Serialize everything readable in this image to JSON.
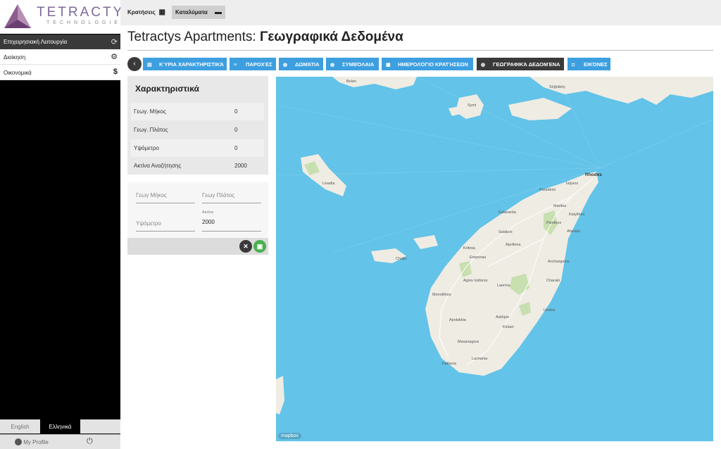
{
  "brand": {
    "name": "TETRACTYS",
    "sub": "TECHNOLOGIES"
  },
  "sidebar": {
    "section_label": "Επιχειρησιακή Λειτουργία",
    "section_icon": "refresh-icon",
    "items": [
      {
        "label": "Διοίκηση",
        "icon": "gear-icon"
      },
      {
        "label": "Οικονομικά",
        "icon": "dollar-icon"
      }
    ],
    "languages": [
      {
        "label": "English",
        "active": false
      },
      {
        "label": "Ελληνικά",
        "active": true
      }
    ],
    "profile_label": "My Profile",
    "profile_icon": "account-circle-icon",
    "logout_icon": "power-icon"
  },
  "topbar": {
    "buttons": [
      {
        "label": "Κρατήσεις",
        "icon": "calendar-icon"
      },
      {
        "label": "Καταλύματα",
        "icon": "bed-icon"
      }
    ]
  },
  "page": {
    "title_prefix": "Tetractys Apartments:",
    "title_main": "Γεωγραφικά Δεδομένα"
  },
  "tabs": [
    {
      "label": "ΚΎΡΙΑ ΧΑΡΑΚΤΗΡΙΣΤΙΚΆ",
      "icon": "document-icon",
      "active": false
    },
    {
      "label": "ΠΑΡΟΧΈΣ",
      "icon": "list-icon",
      "active": false
    },
    {
      "label": "ΔΩΜΆΤΙΑ",
      "icon": "globe-icon",
      "active": false
    },
    {
      "label": "ΣΥΜΒΌΛΑΙΑ",
      "icon": "globe-icon",
      "active": false
    },
    {
      "label": "ΗΜΕΡΟΛΌΓΙΟ ΚΡΑΤΉΣΕΩΝ",
      "icon": "calendar-icon",
      "active": false
    },
    {
      "label": "ΓΕΩΓΡΑΦΙΚΆ ΔΕΔΟΜΈΝΑ",
      "icon": "globe-icon",
      "active": true
    },
    {
      "label": "ΕΙΚΌΝΕΣ",
      "icon": "camera-icon",
      "active": false
    }
  ],
  "characteristics": {
    "title": "Χαρακτηριστικά",
    "rows": [
      {
        "label": "Γεωγ. Μήκος",
        "value": "0"
      },
      {
        "label": "Γεωγ. Πλάτος",
        "value": "0"
      },
      {
        "label": "Υψόμετρο",
        "value": "0"
      },
      {
        "label": "Ακτίνα Αναζήτησης",
        "value": "2000"
      }
    ]
  },
  "form": {
    "longitude_placeholder": "Γεωγ Μήκος",
    "latitude_placeholder": "Γεωγ Πλάτος",
    "altitude_placeholder": "Υψόμετρο",
    "radius_label": "Ακτίνα",
    "radius_value": "2000",
    "cancel_icon": "close-icon",
    "save_icon": "save-icon",
    "colors": {
      "cancel": "#3a3a3a",
      "save": "#4caf50"
    }
  },
  "map": {
    "attribution": "mapbox",
    "places": [
      "Belen",
      "Söğütköy",
      "Symi",
      "Rhodes",
      "Ialysos",
      "Paradeisi",
      "Maritsa",
      "Kalythies",
      "Kalavarda",
      "Psinthos",
      "Afantou",
      "Livadia",
      "Salakos",
      "Apollona",
      "Kritinia",
      "Chalki",
      "Emponas",
      "Archangelos",
      "Agios Isidoros",
      "Charaki",
      "Laerma",
      "Monolithos",
      "Lindos",
      "Asklipio",
      "Apolakkia",
      "Kiotari",
      "Mesanagros",
      "Lachania",
      "Kattavia"
    ],
    "colors": {
      "sea": "#63c3e8",
      "land": "#efece4",
      "park": "#c8dfb0",
      "road": "#ffffff"
    }
  }
}
